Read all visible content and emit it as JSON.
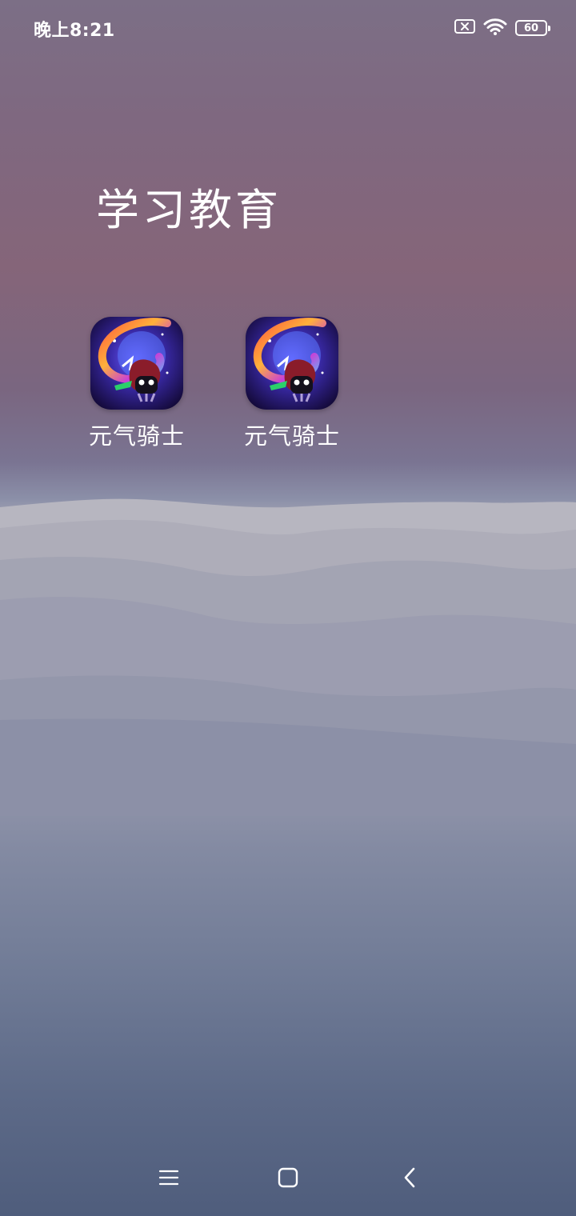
{
  "status_bar": {
    "time": "晚上8:21",
    "battery_level": "60",
    "icons": [
      "no-sim-icon",
      "wifi-icon",
      "battery-icon"
    ]
  },
  "folder": {
    "title": "学习教育",
    "apps": [
      {
        "label": "元气骑士",
        "icon": "soul-knight-app-icon"
      },
      {
        "label": "元气骑士",
        "icon": "soul-knight-app-icon"
      }
    ]
  },
  "nav_bar": {
    "buttons": [
      "menu-icon",
      "home-icon",
      "back-icon"
    ]
  }
}
